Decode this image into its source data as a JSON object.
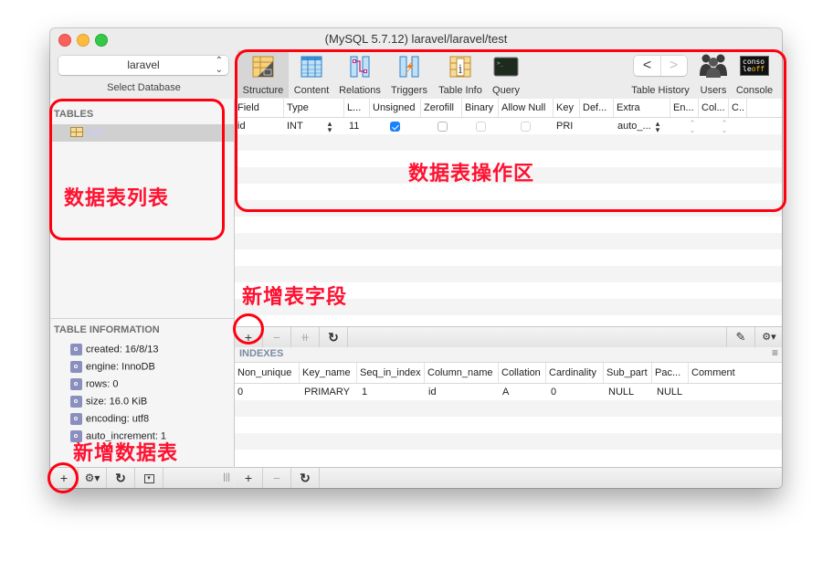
{
  "window": {
    "title": "(MySQL 5.7.12) laravel/laravel/test"
  },
  "sidebar": {
    "database_select": {
      "value": "laravel",
      "label": "Select Database"
    },
    "tables_header": "TABLES",
    "tables": [
      {
        "name": "test",
        "selected": true
      }
    ],
    "info_header": "TABLE INFORMATION",
    "info_items": [
      "created: 16/8/13",
      "engine: InnoDB",
      "rows: 0",
      "size: 16.0 KiB",
      "encoding: utf8",
      "auto_increment: 1"
    ],
    "bottom_bar": {
      "add": "+",
      "gear": "⚙▾",
      "refresh": "↻",
      "filter": "▾",
      "grip": "|||"
    }
  },
  "toolbar": {
    "items": [
      {
        "label": "Structure",
        "icon": "structure-icon",
        "active": true
      },
      {
        "label": "Content",
        "icon": "content-icon",
        "active": false
      },
      {
        "label": "Relations",
        "icon": "relations-icon",
        "active": false
      },
      {
        "label": "Triggers",
        "icon": "triggers-icon",
        "active": false
      },
      {
        "label": "Table Info",
        "icon": "table-info-icon",
        "active": false
      },
      {
        "label": "Query",
        "icon": "query-icon",
        "active": false
      }
    ],
    "table_history": {
      "label": "Table History",
      "back": "<",
      "forward": ">"
    },
    "users": {
      "label": "Users"
    },
    "console": {
      "label": "Console",
      "icon_text_top": "conso",
      "icon_text_mid": "le",
      "icon_text_off": "off"
    }
  },
  "structure": {
    "columns": [
      "Field",
      "Type",
      "L...",
      "Unsigned",
      "Zerofill",
      "Binary",
      "Allow Null",
      "Key",
      "Def...",
      "Extra",
      "En...",
      "Col...",
      "C.."
    ],
    "rows": [
      {
        "field": "id",
        "type": "INT",
        "length": "11",
        "unsigned": true,
        "zerofill": false,
        "binary": false,
        "allow_null": false,
        "key": "PRI",
        "default": "",
        "extra": "auto_...",
        "encoding": "",
        "collation": "",
        "comment": ""
      }
    ],
    "bottom_bar": {
      "add": "+",
      "remove": "−",
      "duplicate": "⧺",
      "refresh": "↻",
      "edit": "✎",
      "gear": "⚙▾"
    }
  },
  "indexes": {
    "header": "INDEXES",
    "columns": [
      "Non_unique",
      "Key_name",
      "Seq_in_index",
      "Column_name",
      "Collation",
      "Cardinality",
      "Sub_part",
      "Pac...",
      "Comment"
    ],
    "rows": [
      [
        "0",
        "PRIMARY",
        "1",
        "id",
        "A",
        "0",
        "NULL",
        "NULL",
        ""
      ]
    ],
    "bottom_bar": {
      "add": "+",
      "remove": "−",
      "refresh": "↻"
    }
  },
  "annotations": {
    "table_list": "数据表列表",
    "operation_area": "数据表操作区",
    "add_field": "新增表字段",
    "add_table": "新增数据表"
  },
  "colors": {
    "annotation_red": "#ff0010",
    "checkbox_blue": "#1a82fb",
    "sidebar_bg": "#f5f5f5"
  }
}
